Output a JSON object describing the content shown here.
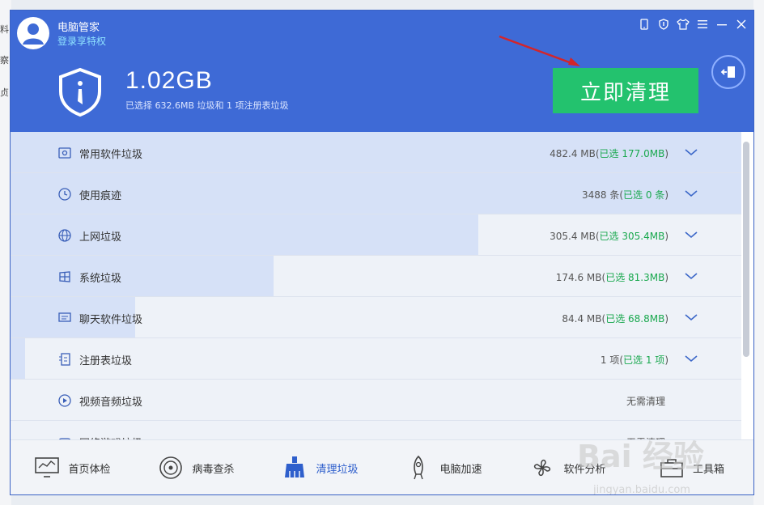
{
  "app": {
    "title": "电脑管家",
    "login_link": "登录享特权"
  },
  "summary": {
    "size": "1.02GB",
    "detail": "已选择 632.6MB 垃圾和 1 项注册表垃圾"
  },
  "actions": {
    "clean_label": "立即清理"
  },
  "items": [
    {
      "label": "常用软件垃圾",
      "size": "482.4 MB(",
      "selected": "已选 177.0MB",
      "close": ")",
      "fill_fraction": 1.0,
      "icon": "hdd-icon"
    },
    {
      "label": "使用痕迹",
      "size": "3488 条(",
      "selected": "已选 0 条",
      "close": ")",
      "fill_fraction": 1.0,
      "icon": "clock-icon"
    },
    {
      "label": "上网垃圾",
      "size": "305.4 MB(",
      "selected": "已选 305.4MB",
      "close": ")",
      "fill_fraction": 0.64,
      "icon": "globe-icon"
    },
    {
      "label": "系统垃圾",
      "size": "174.6 MB(",
      "selected": "已选 81.3MB",
      "close": ")",
      "fill_fraction": 0.36,
      "icon": "windows-icon"
    },
    {
      "label": "聊天软件垃圾",
      "size": "84.4 MB(",
      "selected": "已选 68.8MB",
      "close": ")",
      "fill_fraction": 0.17,
      "icon": "chat-icon"
    },
    {
      "label": "注册表垃圾",
      "size": "1 项(",
      "selected": "已选 1 项",
      "close": ")",
      "fill_fraction": 0.02,
      "icon": "registry-icon"
    },
    {
      "label": "视频音频垃圾",
      "size": "无需清理",
      "selected": "",
      "close": "",
      "fill_fraction": 0,
      "icon": "play-icon"
    },
    {
      "label": "网络游戏垃圾",
      "size": "无需清理",
      "selected": "",
      "close": "",
      "fill_fraction": 0,
      "icon": "game-icon"
    }
  ],
  "nav": [
    {
      "label": "首页体检",
      "icon": "monitor-icon"
    },
    {
      "label": "病毒查杀",
      "icon": "target-icon"
    },
    {
      "label": "清理垃圾",
      "icon": "broom-icon"
    },
    {
      "label": "电脑加速",
      "icon": "rocket-icon"
    },
    {
      "label": "软件分析",
      "icon": "fan-icon"
    },
    {
      "label": "工具箱",
      "icon": "toolbox-icon"
    }
  ],
  "desktop": {
    "left_chars": [
      "料",
      "察",
      "贞"
    ]
  },
  "watermark": {
    "brand": "Bai 经验",
    "url": "jingyan.baidu.com"
  },
  "colors": {
    "header": "#3e6ad6",
    "accent_green": "#23c26e",
    "selected_green": "#19a84e"
  }
}
